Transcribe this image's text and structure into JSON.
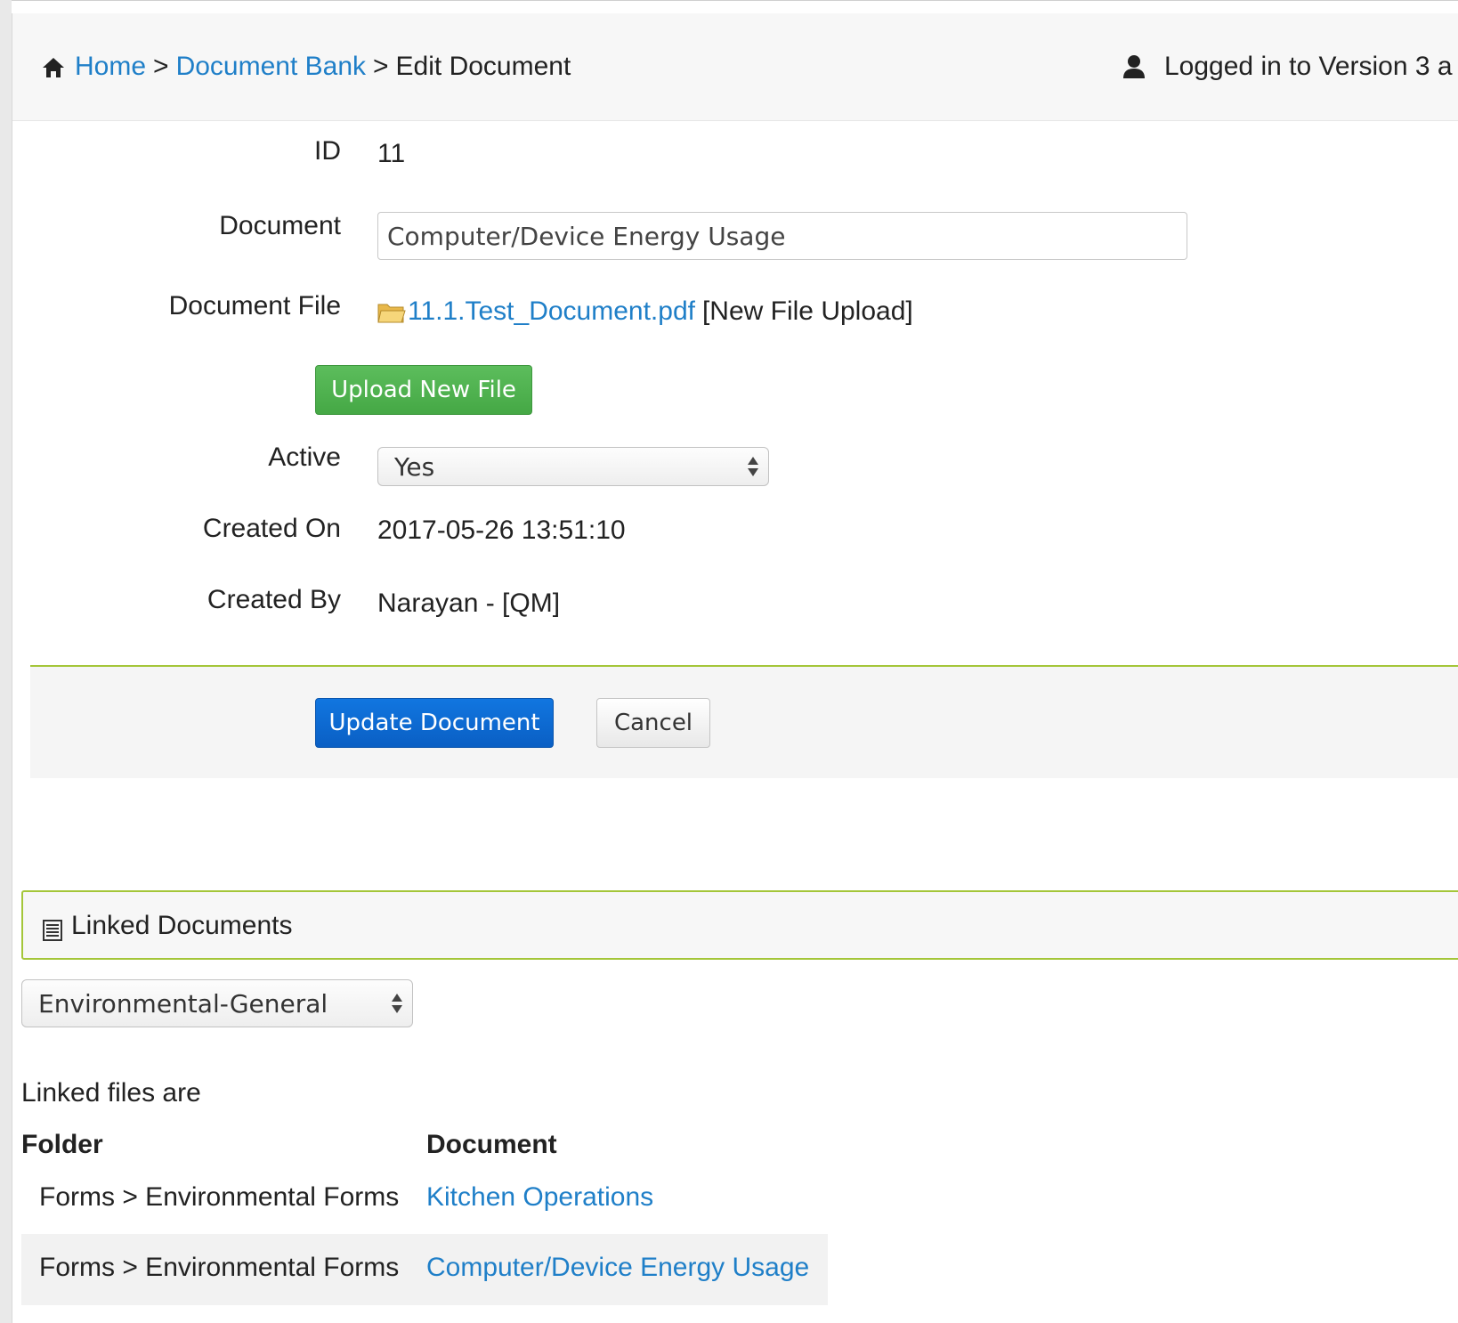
{
  "header": {
    "breadcrumb": {
      "home": "Home",
      "sep1": ">",
      "document_bank": "Document Bank",
      "sep2": ">",
      "current": "Edit Document"
    },
    "login_text": "Logged in to Version 3 a"
  },
  "form": {
    "id_label": "ID",
    "id_value": "11",
    "document_label": "Document",
    "document_value": "Computer/Device Energy Usage",
    "file_label": "Document File",
    "file_name": "11.1.Test_Document.pdf",
    "file_upload_text": "[New File Upload]",
    "upload_button": "Upload New File",
    "active_label": "Active",
    "active_value": "Yes",
    "created_on_label": "Created On",
    "created_on_value": "2017-05-26 13:51:10",
    "created_by_label": "Created By",
    "created_by_value": "Narayan - [QM]",
    "update_button": "Update Document",
    "cancel_button": "Cancel"
  },
  "linked": {
    "title": "Linked Documents",
    "category_value": "Environmental-General",
    "files_intro": "Linked files are",
    "columns": {
      "folder": "Folder",
      "document": "Document"
    },
    "rows": [
      {
        "folder": "Forms > Environmental Forms",
        "document": "Kitchen Operations"
      },
      {
        "folder": "Forms > Environmental Forms",
        "document": "Computer/Device Energy Usage"
      }
    ]
  },
  "colors": {
    "link": "#1f7fc8",
    "success": "#45a845",
    "primary": "#0a5fc4",
    "panel_border": "#a4c639"
  }
}
